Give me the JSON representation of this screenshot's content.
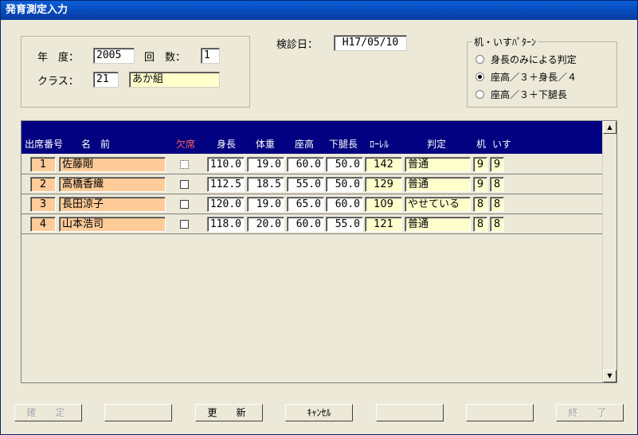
{
  "window": {
    "title": "発育測定入力"
  },
  "header": {
    "year_label": "年　度：",
    "year_value": "2005",
    "count_label": "回　数：",
    "count_value": "1",
    "class_label": "クラス：",
    "class_code": "21",
    "class_name": "あか組",
    "exam_date_label": "検診日：",
    "exam_date_value": "H17/05/10"
  },
  "pattern": {
    "legend": "机・いすﾊﾟﾀｰﾝ",
    "options": [
      "身長のみによる判定",
      "座高／３＋身長／４",
      "座高／３＋下腿長"
    ],
    "selected_index": 1
  },
  "table": {
    "columns": [
      "出席番号",
      "名　前",
      "欠席",
      "身長",
      "体重",
      "座高",
      "下腿長",
      "ﾛｰﾚﾙ",
      "判定",
      "机",
      "いす"
    ],
    "rows": [
      {
        "no": "1",
        "name": "佐藤剛",
        "absent": false,
        "height": "110.0",
        "weight": "19.0",
        "sitting": "60.0",
        "leg": "50.0",
        "rohrer": "142",
        "judgement": "普通",
        "desk": "9",
        "chair": "9"
      },
      {
        "no": "2",
        "name": "高橋香織",
        "absent": false,
        "height": "112.5",
        "weight": "18.5",
        "sitting": "55.0",
        "leg": "50.0",
        "rohrer": "129",
        "judgement": "普通",
        "desk": "9",
        "chair": "8"
      },
      {
        "no": "3",
        "name": "長田涼子",
        "absent": false,
        "height": "120.0",
        "weight": "19.0",
        "sitting": "65.0",
        "leg": "60.0",
        "rohrer": "109",
        "judgement": "やせている",
        "desk": "8",
        "chair": "8"
      },
      {
        "no": "4",
        "name": "山本浩司",
        "absent": false,
        "height": "118.0",
        "weight": "20.0",
        "sitting": "60.0",
        "leg": "55.0",
        "rohrer": "121",
        "judgement": "普通",
        "desk": "8",
        "chair": "8"
      }
    ]
  },
  "buttons": {
    "confirm": "確　定",
    "blank1": "",
    "update": "更　新",
    "cancel": "ｷｬﾝｾﾙ",
    "blank2": "",
    "blank3": "",
    "exit": "終　了"
  },
  "scrollbar": {
    "up_icon": "arrow-up-icon",
    "down_icon": "arrow-down-icon"
  }
}
